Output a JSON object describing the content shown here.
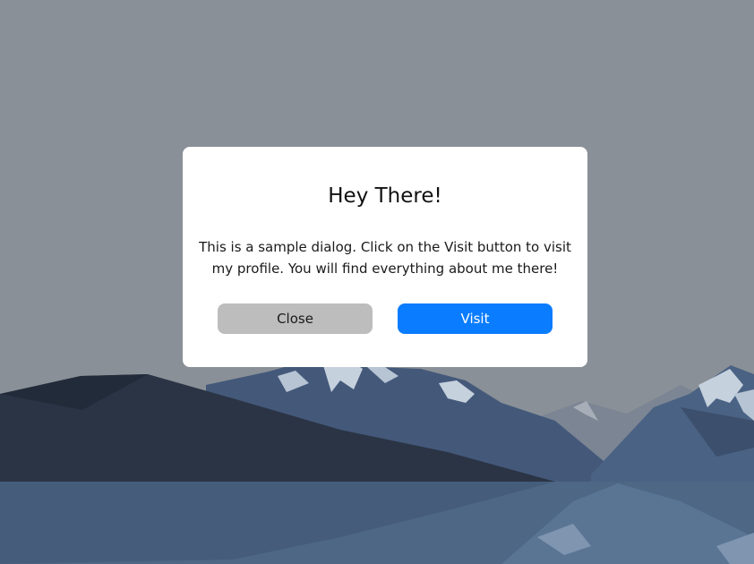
{
  "colors": {
    "sky": "#8a9097",
    "dialog_bg": "#ffffff",
    "close_button_bg": "#bdbdbd",
    "visit_button_bg": "#0a7cff",
    "mountain_dark": "#2b3445",
    "mountain_blue": "#44597a",
    "water": "#4d6785"
  },
  "dialog": {
    "title": "Hey There!",
    "message": "This is a sample dialog. Click on the Visit button to visit my profile. You will find everything about me there!",
    "close_label": "Close",
    "visit_label": "Visit"
  },
  "background": {
    "scene": "mountain-lake-illustration"
  }
}
